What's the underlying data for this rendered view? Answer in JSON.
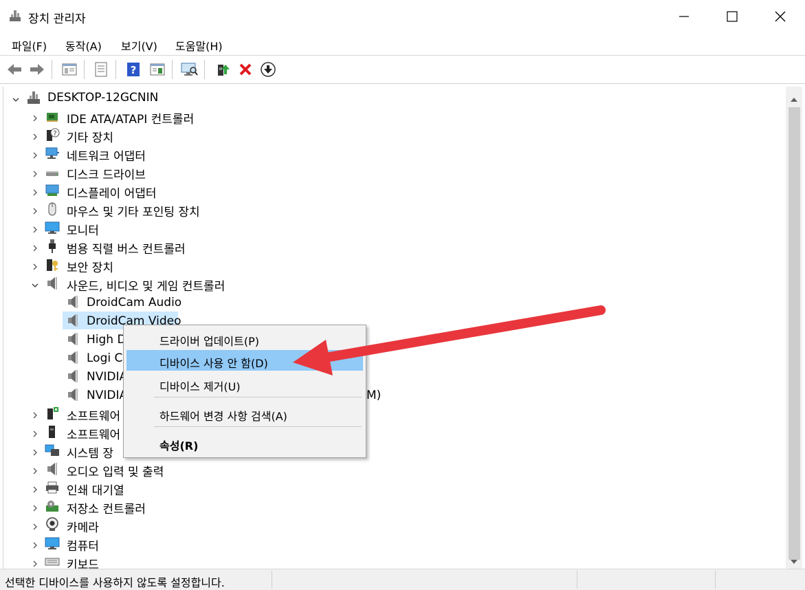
{
  "window": {
    "title": "장치 관리자"
  },
  "menu": [
    "파일(F)",
    "동작(A)",
    "보기(V)",
    "도움말(H)"
  ],
  "toolbar_icons": [
    "back-icon",
    "forward-icon",
    "show-hide-tree-icon",
    "properties-icon",
    "help-icon",
    "view-icon",
    "scan-hardware-icon",
    "update-driver-icon",
    "uninstall-icon",
    "disable-icon"
  ],
  "tree": {
    "root": "DESKTOP-12GCNIN",
    "categories": [
      {
        "label": "IDE ATA/ATAPI 컨트롤러",
        "icon": "ide-controller-icon"
      },
      {
        "label": "기타 장치",
        "icon": "other-device-icon"
      },
      {
        "label": "네트워크 어댑터",
        "icon": "network-adapter-icon"
      },
      {
        "label": "디스크 드라이브",
        "icon": "disk-drive-icon"
      },
      {
        "label": "디스플레이 어댑터",
        "icon": "display-adapter-icon"
      },
      {
        "label": "마우스 및 기타 포인팅 장치",
        "icon": "mouse-icon"
      },
      {
        "label": "모니터",
        "icon": "monitor-icon"
      },
      {
        "label": "범용 직렬 버스 컨트롤러",
        "icon": "usb-icon"
      },
      {
        "label": "보안 장치",
        "icon": "security-device-icon"
      },
      {
        "label": "사운드, 비디오 및 게임 컨트롤러",
        "icon": "speaker-icon"
      }
    ],
    "sound_children": [
      "DroidCam Audio",
      "DroidCam Video",
      "High D",
      "Logi C",
      "NVIDIA",
      "NVIDIA"
    ],
    "sound_child_suffix": "M)",
    "categories_after": [
      {
        "label": "소프트웨어",
        "icon": "software-component-icon"
      },
      {
        "label": "소프트웨어",
        "icon": "software-device-icon"
      },
      {
        "label": "시스템 장",
        "icon": "system-device-icon"
      },
      {
        "label": "오디오 입력 및 출력",
        "icon": "audio-io-icon"
      },
      {
        "label": "인쇄 대기열",
        "icon": "print-queue-icon"
      },
      {
        "label": "저장소 컨트롤러",
        "icon": "storage-controller-icon"
      },
      {
        "label": "카메라",
        "icon": "camera-icon"
      },
      {
        "label": "컴퓨터",
        "icon": "computer-icon"
      },
      {
        "label": "키보드",
        "icon": "keyboard-icon"
      }
    ]
  },
  "context_menu": {
    "update_driver": "드라이버 업데이트(P)",
    "disable_device": "디바이스 사용 안 함(D)",
    "uninstall_device": "디바이스 제거(U)",
    "scan_hardware": "하드웨어 변경 사항 검색(A)",
    "properties": "속성(R)"
  },
  "status": {
    "text": "선택한 디바이스를 사용하지 않도록 설정합니다."
  },
  "colors": {
    "selection": "#cce8ff",
    "menu_highlight": "#91c9f7",
    "annotation_arrow": "#e8363c"
  }
}
